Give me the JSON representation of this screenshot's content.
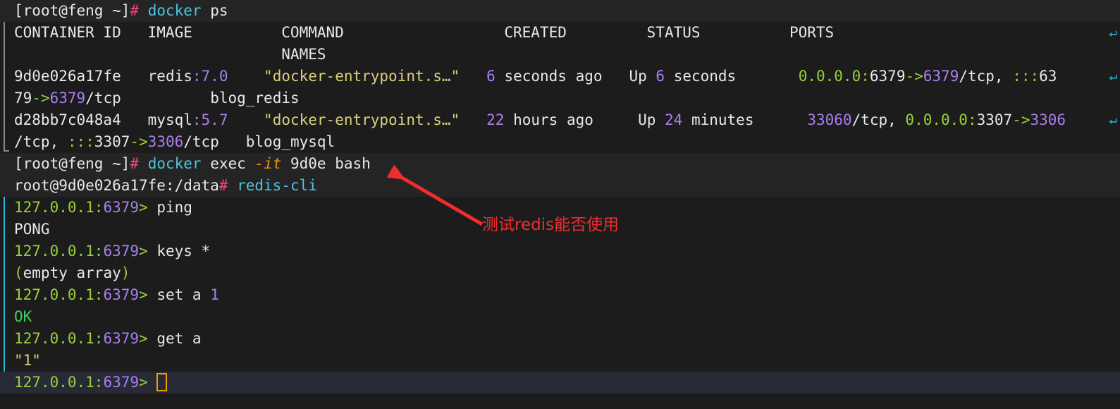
{
  "terminal": {
    "background": "#1c1c1c",
    "prompt_row_background": "#242424",
    "active_row_background": "#282a36",
    "wrap_marker_glyph": "↵",
    "wrap_marker_color": "#25b4d8",
    "cursor_color": "#f0a000"
  },
  "lines": {
    "l1": {
      "bracket_open": "[",
      "user_host": "root@feng ~",
      "bracket_close": "]",
      "hash": "#",
      "cmd": "docker",
      "args": " ps"
    },
    "l2": {
      "headers": "CONTAINER ID   IMAGE          COMMAND                  CREATED         STATUS          PORTS"
    },
    "l3": {
      "names_header": "                              NAMES"
    },
    "l4": {
      "container_id": "9d0e026a17fe",
      "image_name": "redis",
      "image_colon": ":",
      "image_tag": "7.0",
      "command": "\"docker-entrypoint.s…\"",
      "created_num": "6",
      "created_rest": " seconds ago",
      "status_up": "Up ",
      "status_num": "6",
      "status_rest": " seconds",
      "ports_ip": "0.0.0.0",
      "ports_colon": ":",
      "ports_hostport": "6379",
      "ports_arrow": "->",
      "ports_containerport": "6379",
      "ports_proto": "/tcp, ",
      "ports_v6": ":::",
      "ports_v6_num": "63"
    },
    "l5": {
      "wrap_port": "79",
      "wrap_arrow": "->",
      "wrap_target": "6379",
      "wrap_proto": "/tcp",
      "names_value": "blog_redis"
    },
    "l6": {
      "container_id": "d28bb7c048a4",
      "image_name": "mysql",
      "image_colon": ":",
      "image_tag": "5.7",
      "command": "\"docker-entrypoint.s…\"",
      "created_num": "22",
      "created_rest": " hours ago",
      "status_up": "Up ",
      "status_num": "24",
      "status_rest": " minutes",
      "ports_first_num": "33060",
      "ports_first_proto": "/tcp, ",
      "ports_ip": "0.0.0.0",
      "ports_colon": ":",
      "ports_hostport": "3307",
      "ports_arrow": "->",
      "ports_containerport": "3306"
    },
    "l7": {
      "wrap_proto": "/tcp, ",
      "wrap_v6": ":::",
      "wrap_hostport": "3307",
      "wrap_arrow": "->",
      "wrap_containerport": "3306",
      "wrap_proto2": "/tcp",
      "names_value": "blog_mysql"
    },
    "l8": {
      "bracket_open": "[",
      "user_host": "root@feng ~",
      "bracket_close": "]",
      "hash": "#",
      "cmd": "docker",
      "args_exec": " exec ",
      "flag": "-it",
      "args_rest": " 9d0e bash"
    },
    "l9": {
      "user_host_path": "root@9d0e026a17fe:/data",
      "hash": "#",
      "cmd": "redis-cli"
    },
    "l10": {
      "redis_host": "127.0.0.1",
      "redis_colon": ":",
      "redis_port": "6379",
      "redis_gt": ">",
      "command": " ping"
    },
    "l11": {
      "output": "PONG"
    },
    "l12": {
      "redis_host": "127.0.0.1",
      "redis_colon": ":",
      "redis_port": "6379",
      "redis_gt": ">",
      "command": " keys *"
    },
    "l13": {
      "paren_open": "(",
      "text": "empty array",
      "paren_close": ")"
    },
    "l14": {
      "redis_host": "127.0.0.1",
      "redis_colon": ":",
      "redis_port": "6379",
      "redis_gt": ">",
      "command": " set a ",
      "value": "1"
    },
    "l15": {
      "output": "OK"
    },
    "l16": {
      "redis_host": "127.0.0.1",
      "redis_colon": ":",
      "redis_port": "6379",
      "redis_gt": ">",
      "command": " get a"
    },
    "l17": {
      "output": "\"1\""
    },
    "l18": {
      "redis_host": "127.0.0.1",
      "redis_colon": ":",
      "redis_port": "6379",
      "redis_gt": ">",
      "trailing": " "
    }
  },
  "annotation": {
    "text": "测试redis能否使用",
    "color": "#ef2d2d"
  }
}
